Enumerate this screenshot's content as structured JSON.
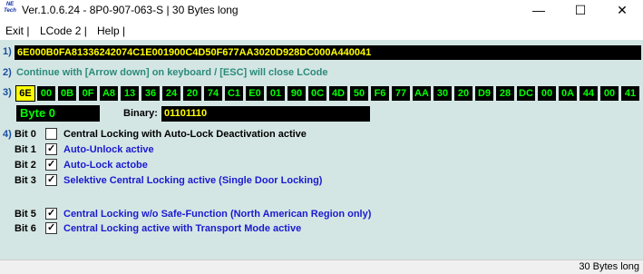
{
  "window": {
    "logo_text": "NE Tech",
    "title": "Ver.1.0.6.24 -   8P0-907-063-S | 30 Bytes long",
    "minimize_glyph": "—",
    "maximize_glyph": "☐",
    "close_glyph": "✕"
  },
  "menu": {
    "items": [
      "Exit |",
      "LCode 2 |",
      "Help |"
    ]
  },
  "steps": {
    "step1": "1)",
    "step2": "2)",
    "step3": "3)",
    "step4": "4)"
  },
  "hex_string": "6E000B0FA81336242074C1E001900C4D50F677AA3020D928DC000A440041",
  "instruction": "Continue with [Arrow down] on keyboard / [ESC] will close LCode",
  "bytes": [
    "6E",
    "00",
    "0B",
    "0F",
    "A8",
    "13",
    "36",
    "24",
    "20",
    "74",
    "C1",
    "E0",
    "01",
    "90",
    "0C",
    "4D",
    "50",
    "F6",
    "77",
    "AA",
    "30",
    "20",
    "D9",
    "28",
    "DC",
    "00",
    "0A",
    "44",
    "00",
    "41"
  ],
  "selected_byte_index": 0,
  "byte_label": "Byte 0",
  "binary_label": "Binary:",
  "binary_value": "01101110",
  "bits": [
    {
      "label": "Bit 0",
      "checked": false,
      "text": "Central Locking with Auto-Lock Deactivation active",
      "color": "#000000"
    },
    {
      "label": "Bit 1",
      "checked": true,
      "text": "Auto-Unlock active",
      "color": "#1a1ad0"
    },
    {
      "label": "Bit 2",
      "checked": true,
      "text": "Auto-Lock actobe",
      "color": "#1a1ad0"
    },
    {
      "label": "Bit 3",
      "checked": true,
      "text": "Selektive Central Locking active (Single Door Locking)",
      "color": "#1a1ad0"
    },
    {
      "label": "Bit 5",
      "checked": true,
      "text": "Central Locking w/o Safe-Function (North American Region only)",
      "color": "#1a1ad0"
    },
    {
      "label": "Bit 6",
      "checked": true,
      "text": "Central Locking active with Transport Mode active",
      "color": "#1a1ad0"
    }
  ],
  "status": "30 Bytes long",
  "colors": {
    "client_bg": "#d4e6e4",
    "hex_text": "#ffff00",
    "byte_text": "#00ff00",
    "instruction": "#2b8a7a",
    "step_number": "#1a4fa0"
  }
}
